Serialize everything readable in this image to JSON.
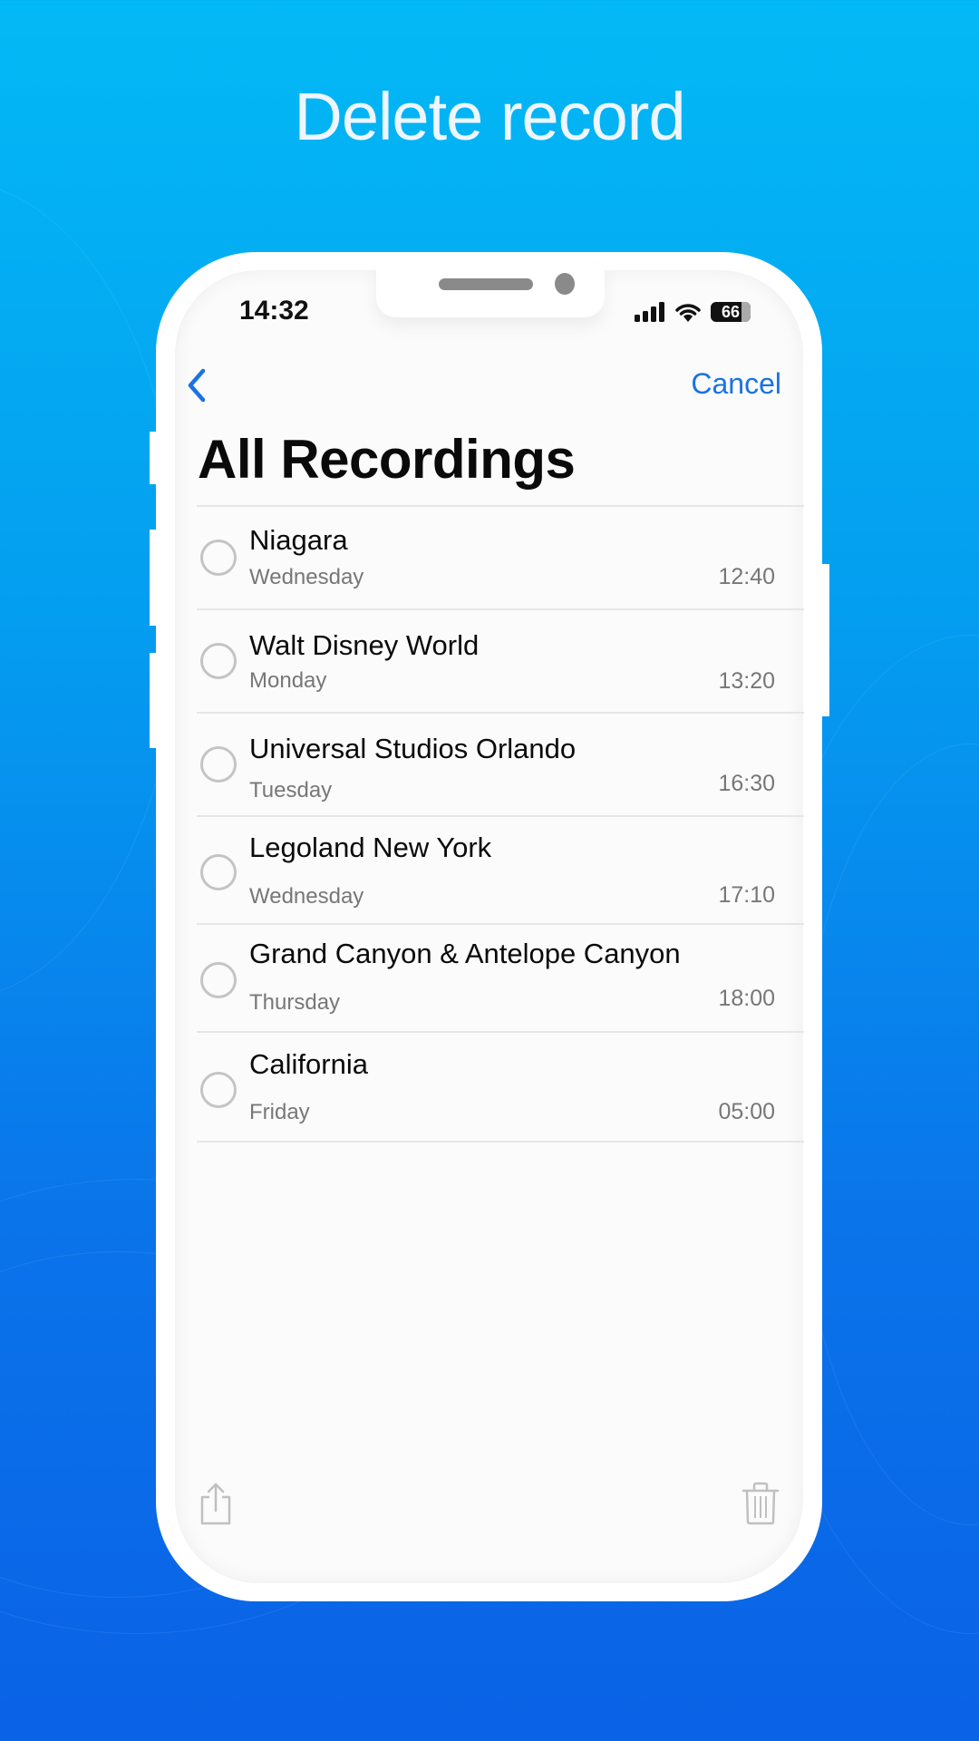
{
  "headline": "Delete record",
  "colors": {
    "background_top": "#03b9f5",
    "background_bottom": "#0a62e6",
    "accent": "#1a73e2",
    "icon_disabled": "#c0c0c0"
  },
  "status_bar": {
    "time": "14:32",
    "battery": "66",
    "icons": [
      "signal-icon",
      "wifi-icon",
      "battery-icon"
    ]
  },
  "nav": {
    "back_icon": "chevron-left-icon",
    "cancel_label": "Cancel"
  },
  "page_title": "All Recordings",
  "recordings": [
    {
      "name": "Niagara",
      "day": "Wednesday",
      "duration": "12:40",
      "selected": false
    },
    {
      "name": "Walt Disney World",
      "day": "Monday",
      "duration": "13:20",
      "selected": false
    },
    {
      "name": "Universal Studios Orlando",
      "day": "Tuesday",
      "duration": "16:30",
      "selected": false
    },
    {
      "name": "Legoland New York",
      "day": "Wednesday",
      "duration": "17:10",
      "selected": false
    },
    {
      "name": "Grand Canyon & Antelope Canyon",
      "day": "Thursday",
      "duration": "18:00",
      "selected": false
    },
    {
      "name": "California",
      "day": "Friday",
      "duration": "05:00",
      "selected": false
    }
  ],
  "toolbar": {
    "share_icon": "share-icon",
    "delete_icon": "trash-icon",
    "enabled": false
  }
}
